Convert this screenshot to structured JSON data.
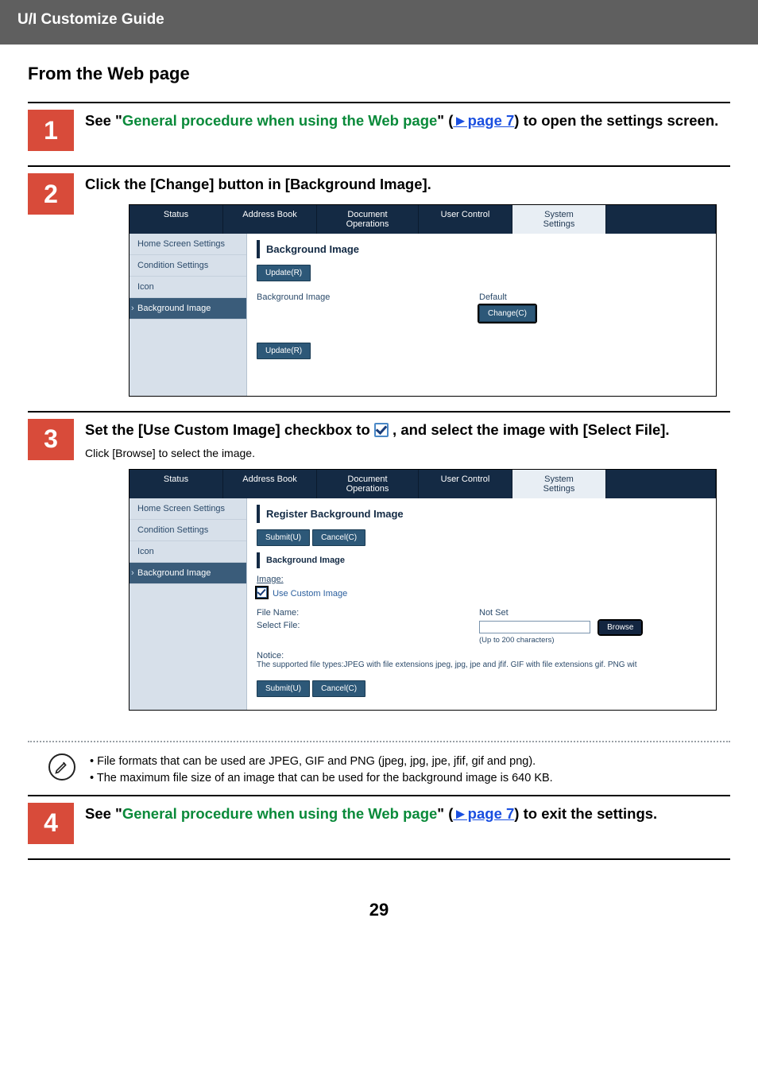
{
  "header": {
    "title": "U/I Customize Guide"
  },
  "section_title": "From the Web page",
  "steps": {
    "s1": {
      "num": "1",
      "pre": "See \"",
      "link1": "General procedure when using the Web page",
      "mid": "\" (",
      "page_link": "►page 7",
      "post": ") to open the settings screen."
    },
    "s2": {
      "num": "2",
      "heading": "Click the [Change] button in [Background Image].",
      "tabs": {
        "status": "Status",
        "address": "Address Book",
        "doc": "Document\nOperations",
        "user": "User Control",
        "sys": "System\nSettings"
      },
      "nav": {
        "home": "Home Screen Settings",
        "cond": "Condition Settings",
        "icon": "Icon",
        "bg": "Background Image"
      },
      "pane": {
        "title": "Background Image",
        "update": "Update(R)",
        "row_label": "Background Image",
        "default": "Default",
        "change": "Change(C)"
      }
    },
    "s3": {
      "num": "3",
      "heading_pre": "Set the [Use Custom Image] checkbox to ",
      "heading_post": " , and select the image with [Select File].",
      "sub": "Click [Browse] to select the image.",
      "tabs": {
        "status": "Status",
        "address": "Address Book",
        "doc": "Document\nOperations",
        "user": "User Control",
        "sys": "System\nSettings"
      },
      "nav": {
        "home": "Home Screen Settings",
        "cond": "Condition Settings",
        "icon": "Icon",
        "bg": "Background Image"
      },
      "pane": {
        "title": "Register Background Image",
        "submit": "Submit(U)",
        "cancel": "Cancel(C)",
        "subtitle": "Background Image",
        "image_label": "Image:",
        "use_custom": "Use Custom Image",
        "file_name_label": "File Name:",
        "file_name_value": "Not Set",
        "select_file_label": "Select File:",
        "browse": "Browse",
        "limit": "(Up to 200 characters)",
        "notice_label": "Notice:",
        "notice_text": "The supported file types:JPEG with file extensions jpeg, jpg, jpe and jfif. GIF with file extensions gif. PNG wit"
      }
    },
    "note": {
      "l1": "• File formats that can be used are JPEG, GIF and PNG (jpeg,  jpg, jpe, jfif, gif and png).",
      "l2": "• The maximum file size of an image that can be used for the background image is 640 KB."
    },
    "s4": {
      "num": "4",
      "pre": "See \"",
      "link1": "General procedure when using the Web page",
      "mid": "\" (",
      "page_link": "►page 7",
      "post": ") to exit the settings."
    }
  },
  "pagenum": "29"
}
